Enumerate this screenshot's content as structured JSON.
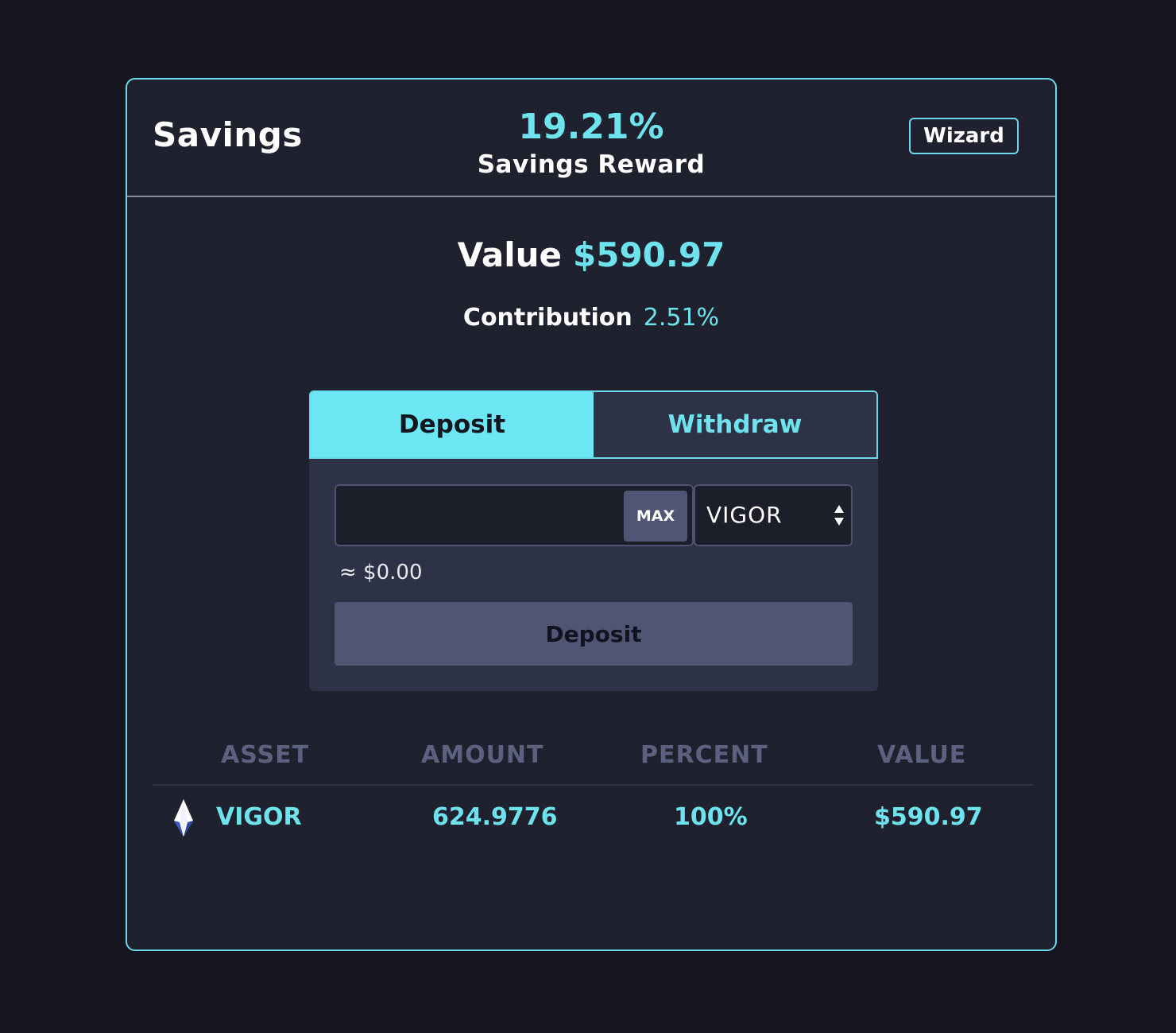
{
  "header": {
    "title": "Savings",
    "reward_pct": "19.21%",
    "reward_label": "Savings Reward",
    "wizard_label": "Wizard"
  },
  "summary": {
    "value_label": "Value",
    "value_amount": "$590.97",
    "contribution_label": "Contribution",
    "contribution_pct": "2.51%"
  },
  "panel": {
    "tabs": [
      {
        "label": "Deposit",
        "active": true
      },
      {
        "label": "Withdraw",
        "active": false
      }
    ],
    "amount_input": {
      "value": "",
      "placeholder": ""
    },
    "max_label": "MAX",
    "asset_selected": "VIGOR",
    "approx_value": "≈ $0.00",
    "submit_label": "Deposit"
  },
  "table": {
    "columns": [
      "ASSET",
      "AMOUNT",
      "PERCENT",
      "VALUE"
    ],
    "rows": [
      {
        "asset": "VIGOR",
        "icon": "vigor-diamond-icon",
        "amount": "624.9776",
        "percent": "100%",
        "value": "$590.97"
      }
    ]
  },
  "colors": {
    "accent": "#6ee3ee",
    "background": "#15161f",
    "card": "#1f212e",
    "panel": "#2d3246",
    "muted": "#5c6180"
  }
}
